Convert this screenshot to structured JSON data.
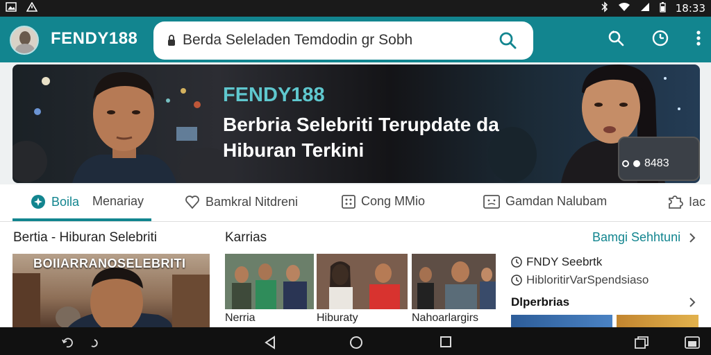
{
  "status_bar": {
    "time": "18:33"
  },
  "app_bar": {
    "brand": "FENDY188",
    "search_value": "Berda Seleladen Temdodin gr Sobh"
  },
  "banner": {
    "brand": "FENDY188",
    "headline": "Berbria Selebriti Terupdate da Hiburan Terkini",
    "count": "8483"
  },
  "tabs": [
    {
      "label": "Boila",
      "icon": "plus-circle-icon",
      "active": true
    },
    {
      "label": "Menariay",
      "icon": "",
      "active": false
    },
    {
      "label": "Bamkral Nitdreni",
      "icon": "heart-icon",
      "active": false
    },
    {
      "label": "Cong MMio",
      "icon": "grid-box-icon",
      "active": false
    },
    {
      "label": "Gamdan Nalubam",
      "icon": "face-box-icon",
      "active": false
    },
    {
      "label": "Iac",
      "icon": "puzzle-icon",
      "active": false
    }
  ],
  "left_section": {
    "title": "Bertia - Hiburan Selebriti",
    "thumb_overlay": "BOIIARRANOSELEBRITI"
  },
  "middle_section": {
    "title": "Karrias",
    "items": [
      {
        "caption": "Nerria"
      },
      {
        "caption": "Hiburaty"
      },
      {
        "caption": "Nahoarlargirs"
      }
    ]
  },
  "right_section": {
    "link": "Bamgi Sehhtuni",
    "items": [
      {
        "label": "FNDY Seebrtk",
        "icon": "clock-icon"
      },
      {
        "label": "HibloritirVarSpendsiaso",
        "icon": "clock-icon"
      }
    ],
    "subsection": "Dlperbrias"
  },
  "colors": {
    "accent": "#12858f",
    "banner_brand": "#5fc7ce"
  }
}
